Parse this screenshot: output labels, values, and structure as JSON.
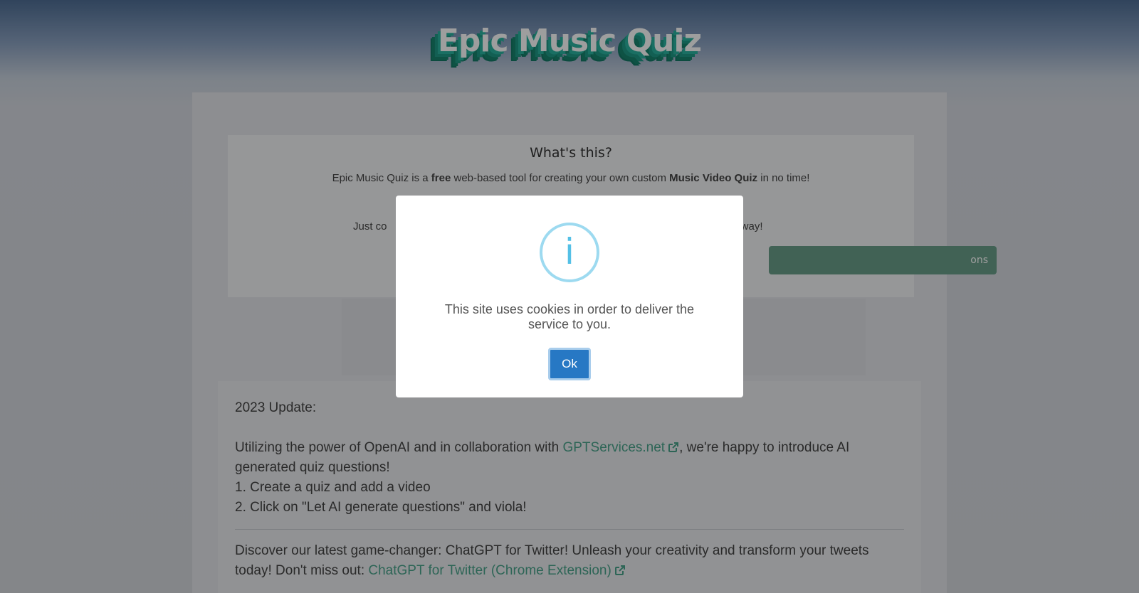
{
  "header": {
    "logo_text": "Epic Music Quiz"
  },
  "intro": {
    "title": "What's this?",
    "line1_pre": "Epic Music Quiz is a ",
    "line1_bold1": "free",
    "line1_mid": " web-based tool for creating your own custom ",
    "line1_bold2": "Music Video Quiz",
    "line1_post": " in no time!",
    "line2_start": "Just co",
    "line2_end": "t away!",
    "button_partial": "ons"
  },
  "update": {
    "heading": "2023 Update:",
    "p1_pre": "Utilizing the power of OpenAI and in collaboration with ",
    "p1_link": "GPTServices.net",
    "p1_post": ", we're happy to introduce AI generated quiz questions!",
    "step1": "1. Create a quiz and add a video",
    "step2": "2. Click on \"Let AI generate questions\" and viola!",
    "p2_pre": "Discover our latest game-changer: ChatGPT for Twitter! Unleash your creativity and transform your tweets today! Don't miss out: ",
    "p2_link": "ChatGPT for Twitter (Chrome Extension)"
  },
  "modal": {
    "icon_glyph": "i",
    "icon": "info-icon",
    "message": "This site uses cookies in order to deliver the service to you.",
    "ok_label": "Ok"
  },
  "colors": {
    "link": "#4aa48c",
    "ok_button": "#2778c4",
    "info_icon": "#54c0e6",
    "logo_shadow": "#1f9a86"
  }
}
